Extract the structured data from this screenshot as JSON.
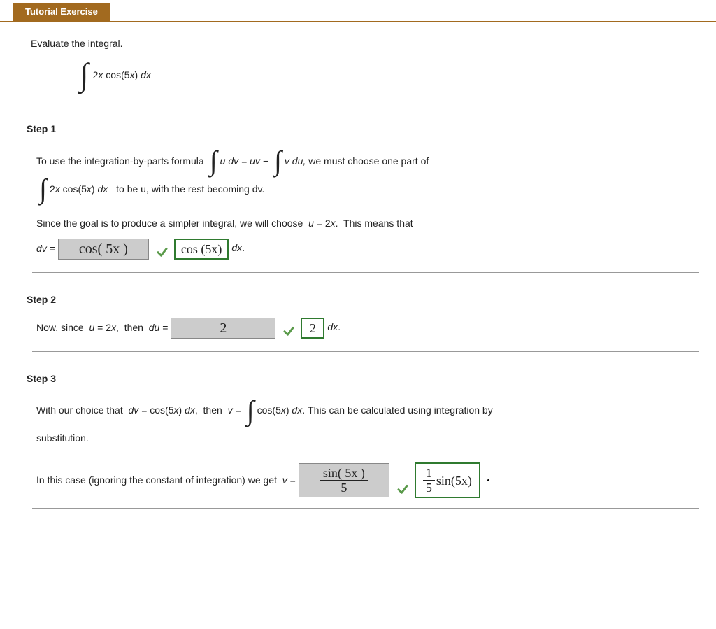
{
  "header": {
    "title": "Tutorial Exercise"
  },
  "prompt": "Evaluate the integral.",
  "integral_expr": {
    "body": "2x cos(5x) dx",
    "two": "2",
    "x": "x",
    "cos": " cos(",
    "five": "5",
    "x2": "x",
    "close": ") ",
    "dx": "dx"
  },
  "step1": {
    "label": "Step 1",
    "line1_a": "To use the integration-by-parts formula",
    "line1_b": "u dv = uv −",
    "line1_c": "v du,",
    "line1_d": "we must choose one part of",
    "line2_a": "2x cos(5x) dx",
    "line2_b": "to be u, with the rest becoming dv.",
    "line3": "Since the goal is to produce a simpler integral, we will choose  u = 2x.  This means that",
    "dv_eq": "dv =",
    "ans_old": "cos( 5x )",
    "ans_new": "cos (5x)",
    "dx": "dx."
  },
  "step2": {
    "label": "Step 2",
    "line_a": "Now, since  u = 2x,  then  du =",
    "ans_old": "2",
    "ans_new": "2",
    "dx": "dx."
  },
  "step3": {
    "label": "Step 3",
    "line1_a": "With our choice that  dv = cos(5x) dx,  then  v =",
    "line1_b": "cos(5x) dx.",
    "line1_c": "This can be calculated using integration by",
    "line1_d": "substitution.",
    "line2_a": "In this case (ignoring the constant of integration) we get  v =",
    "ans_old_num": "sin( 5x )",
    "ans_old_den": "5",
    "ans_new_num": "1",
    "ans_new_den": "5",
    "ans_new_tail": " sin(5x)"
  }
}
